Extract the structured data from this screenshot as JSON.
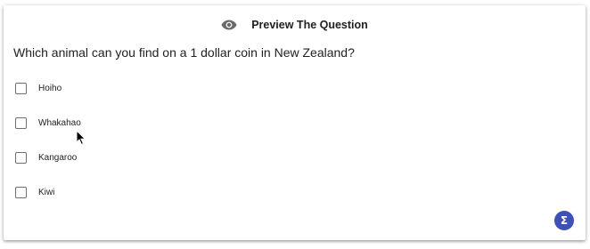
{
  "header": {
    "icon": "eye-icon",
    "title": "Preview The Question"
  },
  "question": {
    "text": "Which animal can you find on a 1 dollar coin in New Zealand?"
  },
  "options": [
    {
      "label": "Hoiho",
      "checked": false
    },
    {
      "label": "Whakahao",
      "checked": false
    },
    {
      "label": "Kangaroo",
      "checked": false
    },
    {
      "label": "Kiwi",
      "checked": false
    }
  ],
  "fab": {
    "icon": "sigma-icon",
    "glyph": "Σ",
    "color": "#3f51b5"
  }
}
